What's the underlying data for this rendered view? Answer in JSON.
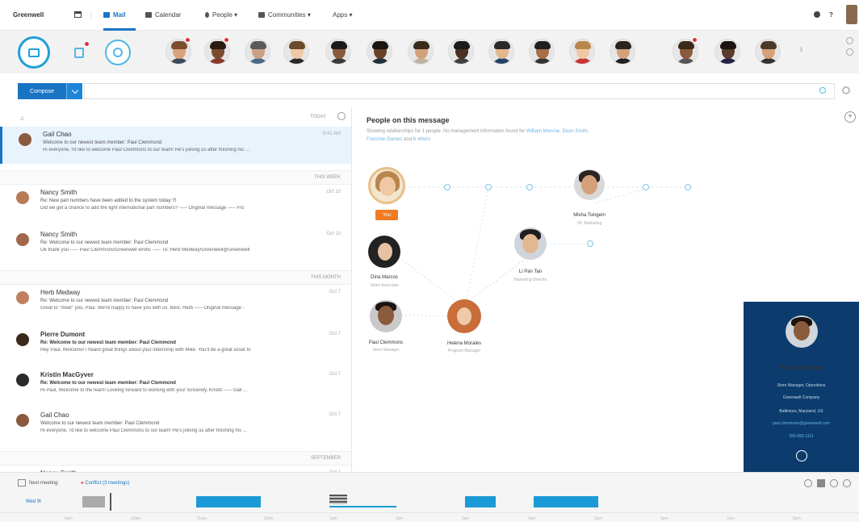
{
  "topbar": {
    "brand": "Greenwell",
    "home_icon": "home-icon",
    "items": [
      {
        "label": "Mail",
        "icon": "mail-icon",
        "active": true
      },
      {
        "label": "Calendar",
        "icon": "calendar-icon"
      },
      {
        "label": "People ▾",
        "icon": "people-icon"
      },
      {
        "label": "Communities ▾",
        "icon": "communities-icon"
      },
      {
        "label": "Apps ▾",
        "icon": "apps-icon"
      }
    ],
    "help": "?"
  },
  "compose": {
    "label": "Compose",
    "search_placeholder": ""
  },
  "maillist": {
    "sections": [
      "TODAY",
      "THIS WEEK",
      "THIS MONTH",
      "SEPTEMBER"
    ],
    "mails": [
      {
        "from": "Gail Chao",
        "subject": "Welcome to our newest team member: Paul Clemmond",
        "preview": "Hi everyone, I'd like to welcome Paul Clemmons to our team! He's joining us after finishing his ...",
        "time": "9:41 AM",
        "bold": false
      },
      {
        "from": "Nancy Smith",
        "subject": "Re: New part numbers have been added to the system today !!!",
        "preview": "Did we get a chance to add the light international part numbers? ----- Original message ----- Fro",
        "time": "Oct 10",
        "bold": false
      },
      {
        "from": "Nancy Smith",
        "subject": "Re: Welcome to our newest team member: Paul Clemmond",
        "preview": "Ok thank you ----- Paul Clemmons/Greenwell wrote: ----- To: Herb Medway/Greenwell@Greenwell",
        "time": "Oct 10",
        "bold": false
      },
      {
        "from": "Herb Medway",
        "subject": "Re: Welcome to our newest team member: Paul Clemmond",
        "preview": "Great to \"meet\" you, Paul. We're happy to have you with us. Best, Herb ----- Original message -",
        "time": "Oct 7",
        "bold": false
      },
      {
        "from": "Pierre Dumont",
        "subject": "Re: Welcome to our newest team member: Paul Clemmond",
        "preview": "Hey Paul, Welcome! I heard great things about your internship with Mike. You'll be a great asset to",
        "time": "Oct 7",
        "bold": true
      },
      {
        "from": "Kristin MacGyver",
        "subject": "Re: Welcome to our newest team member: Paul Clemmond",
        "preview": "Hi Paul, Welcome to the team! Looking forward to working with you! Sincerely, Kristin ----- Gail ...",
        "time": "Oct 7",
        "bold": true
      },
      {
        "from": "Gail Chao",
        "subject": "Welcome to our newest team member: Paul Clemmond",
        "preview": "Hi everyone, I'd like to welcome Paul Clemmons to our team! He's joining us after finishing his ...",
        "time": "Oct 7",
        "bold": false
      },
      {
        "from": "Nancy Smith",
        "subject": "",
        "preview": "",
        "time": "Oct 1",
        "bold": false
      }
    ]
  },
  "people": {
    "title": "People on this message",
    "subtitle_1": "Showing relationships for 1 people. No management information found for",
    "subtitle_links_1": "William Monroe, Dean Smith,",
    "subtitle_links_2": "Francine Gomez",
    "subtitle_mid": "and",
    "subtitle_links_3": "6 others",
    "you_label": "You",
    "nodes": [
      {
        "name": "Misha Tsingein",
        "role": "VP, Marketing"
      },
      {
        "name": "Li Pan Tan",
        "role": "Marketing Director"
      },
      {
        "name": "Dina Marcos",
        "role": "Sales Associate"
      },
      {
        "name": "Paul Clemmons",
        "role": "Store Manager"
      },
      {
        "name": "Helena Morales",
        "role": "Program Manager"
      }
    ]
  },
  "card": {
    "name": "Paul Clemmons",
    "title": "Store Manager, Operations",
    "company": "Greenwell Company",
    "location": "Baltimore, Maryland, US",
    "email": "paul.clemmons@greenwell.com",
    "phone": "555-555-1111",
    "add": "+"
  },
  "bottom": {
    "next_meeting": "Next meeting:",
    "conflict": "Conflict (3 meetings)",
    "day_label": "Wed 9t",
    "ticks": [
      "8am",
      "10am",
      "11am",
      "12pm",
      "1pm",
      "2pm",
      "3pm",
      "4pm",
      "5pm",
      "6pm",
      "7pm",
      "8pm"
    ]
  },
  "colors": {
    "accent": "#1a74c4",
    "event": "#1a9ad6",
    "card_bg": "#0c3c6e",
    "you_tag": "#f07b22"
  }
}
